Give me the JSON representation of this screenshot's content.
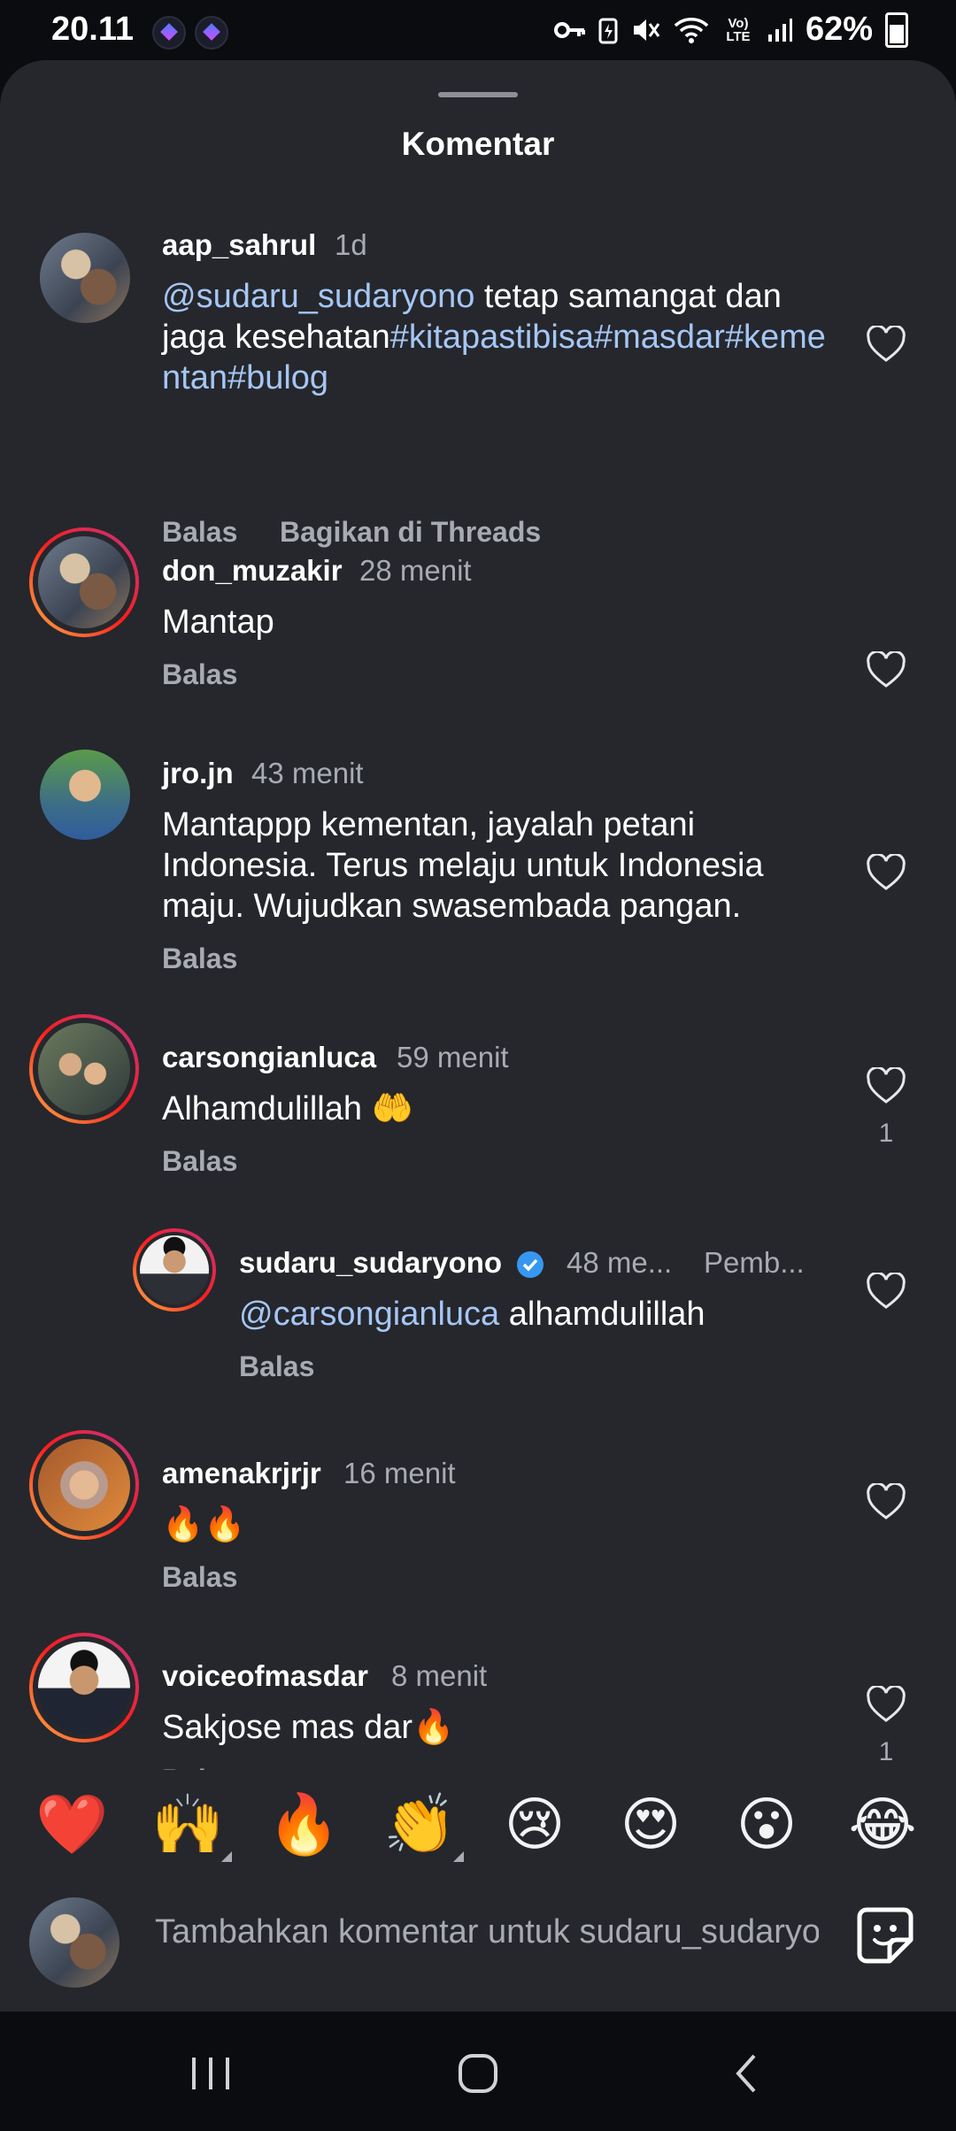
{
  "status_bar": {
    "time": "20.11",
    "battery": "62%",
    "signal_label": "Vo) LTE"
  },
  "sheet": {
    "title": "Komentar"
  },
  "comments": [
    {
      "username": "aap_sahrul",
      "time": "1d",
      "text_parts": [
        {
          "t": "@sudaru_sudaryono",
          "mention": true
        },
        {
          "t": " tetap samangat dan jaga kesehatan",
          "mention": false
        },
        {
          "t": "#kitapastibisa#masdar#kementan#bulog",
          "mention": true
        }
      ],
      "reply": "Balas",
      "share": "Bagikan di Threads"
    },
    {
      "username": "don_muzakir",
      "time": "28 menit",
      "text": "Mantap",
      "reply": "Balas"
    },
    {
      "username": "jro.jn",
      "time": "43 menit",
      "text": "Mantappp kementan, jayalah petani Indonesia. Terus melaju untuk Indonesia maju. Wujudkan swasembada pangan.",
      "reply": "Balas"
    },
    {
      "username": "carsongianluca",
      "time": "59 menit",
      "text": "Alhamdulillah 🤲",
      "reply": "Balas",
      "likes": "1"
    },
    {
      "username": "sudaru_sudaryono",
      "time": "48 me...",
      "author_badge": "Pemb...",
      "mention": "@carsongianluca",
      "text": " alhamdulillah",
      "reply": "Balas"
    },
    {
      "username": "amenakrjrjr",
      "time": "16 menit",
      "text": "🔥🔥",
      "reply": "Balas"
    },
    {
      "username": "voiceofmasdar",
      "time": "8 menit",
      "text": "Sakjose mas dar🔥",
      "reply": "Balas",
      "likes": "1"
    }
  ],
  "emoji_bar": [
    "❤️",
    "🙌",
    "🔥",
    "👏",
    "😢",
    "😍",
    "😮",
    "😂"
  ],
  "composer": {
    "placeholder": "Tambahkan komentar untuk sudaru_sudaryono..."
  },
  "colors": {
    "sheet_bg": "#25272c",
    "mention": "#a5c6f5",
    "secondary_text": "#a8abb1",
    "verified": "#3797f0"
  }
}
